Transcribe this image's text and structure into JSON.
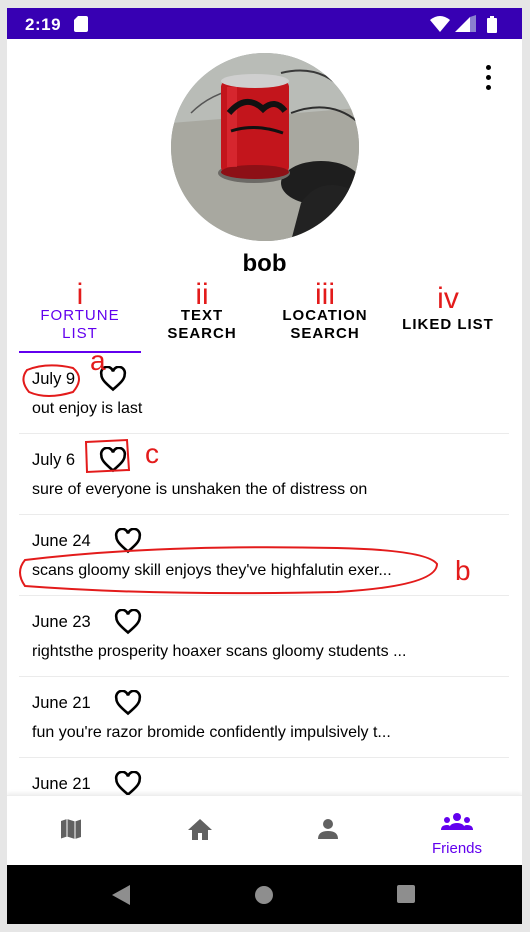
{
  "status_bar": {
    "time": "2:19",
    "icons": [
      "sd-card-icon",
      "wifi-icon",
      "signal-icon",
      "battery-icon"
    ]
  },
  "profile": {
    "username": "bob"
  },
  "tabs": [
    {
      "marker": "i",
      "label_line1": "FORTUNE",
      "label_line2": "LIST",
      "active": true
    },
    {
      "marker": "ii",
      "label_line1": "TEXT",
      "label_line2": "SEARCH",
      "active": false
    },
    {
      "marker": "iii",
      "label_line1": "LOCATION",
      "label_line2": "SEARCH",
      "active": false
    },
    {
      "marker": "iv",
      "label_line1": "LIKED LIST",
      "label_line2": "",
      "active": false
    }
  ],
  "fortunes": [
    {
      "date": "July 9",
      "text": "out enjoy is last"
    },
    {
      "date": "July 6",
      "text": "sure of everyone is unshaken the of distress on"
    },
    {
      "date": "June 24",
      "text": "scans gloomy skill enjoys they've highfalutin exer..."
    },
    {
      "date": "June 23",
      "text": "rightsthe prosperity hoaxer scans gloomy students ..."
    },
    {
      "date": "June 21",
      "text": "fun you're razor bromide confidently impulsively t..."
    },
    {
      "date": "June 21",
      "text": ""
    }
  ],
  "annotations": {
    "a": "a",
    "b": "b",
    "c": "c"
  },
  "bottom_nav": [
    {
      "icon": "map-icon",
      "label": ""
    },
    {
      "icon": "home-icon",
      "label": ""
    },
    {
      "icon": "person-icon",
      "label": ""
    },
    {
      "icon": "friends-icon",
      "label": "Friends",
      "active": true
    }
  ],
  "colors": {
    "status_bar": "#3700b3",
    "accent": "#6200ee",
    "annotation": "#e31b1b",
    "nav_icon": "#616161"
  }
}
